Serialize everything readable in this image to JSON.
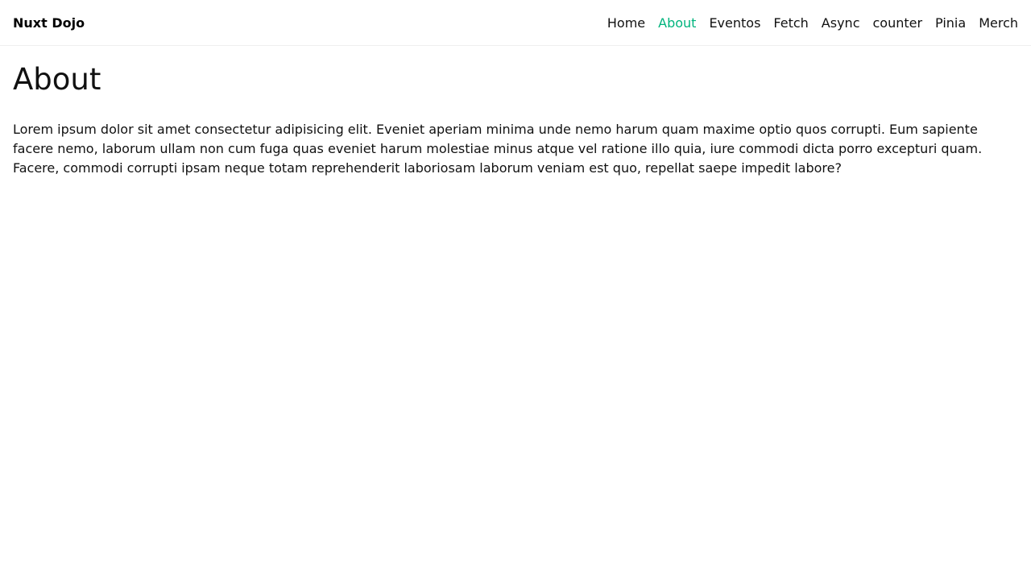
{
  "header": {
    "brand": "Nuxt Dojo",
    "nav": [
      {
        "label": "Home",
        "active": false
      },
      {
        "label": "About",
        "active": true
      },
      {
        "label": "Eventos",
        "active": false
      },
      {
        "label": "Fetch",
        "active": false
      },
      {
        "label": "Async",
        "active": false
      },
      {
        "label": "counter",
        "active": false
      },
      {
        "label": "Pinia",
        "active": false
      },
      {
        "label": "Merch",
        "active": false
      }
    ]
  },
  "main": {
    "title": "About",
    "body": "Lorem ipsum dolor sit amet consectetur adipisicing elit. Eveniet aperiam minima unde nemo harum quam maxime optio quos corrupti. Eum sapiente facere nemo, laborum ullam non cum fuga quas eveniet harum molestiae minus atque vel ratione illo quia, iure commodi dicta porro excepturi quam. Facere, commodi corrupti ipsam neque totam reprehenderit laboriosam laborum veniam est quo, repellat saepe impedit labore?"
  },
  "colors": {
    "accent": "#00b47d"
  }
}
